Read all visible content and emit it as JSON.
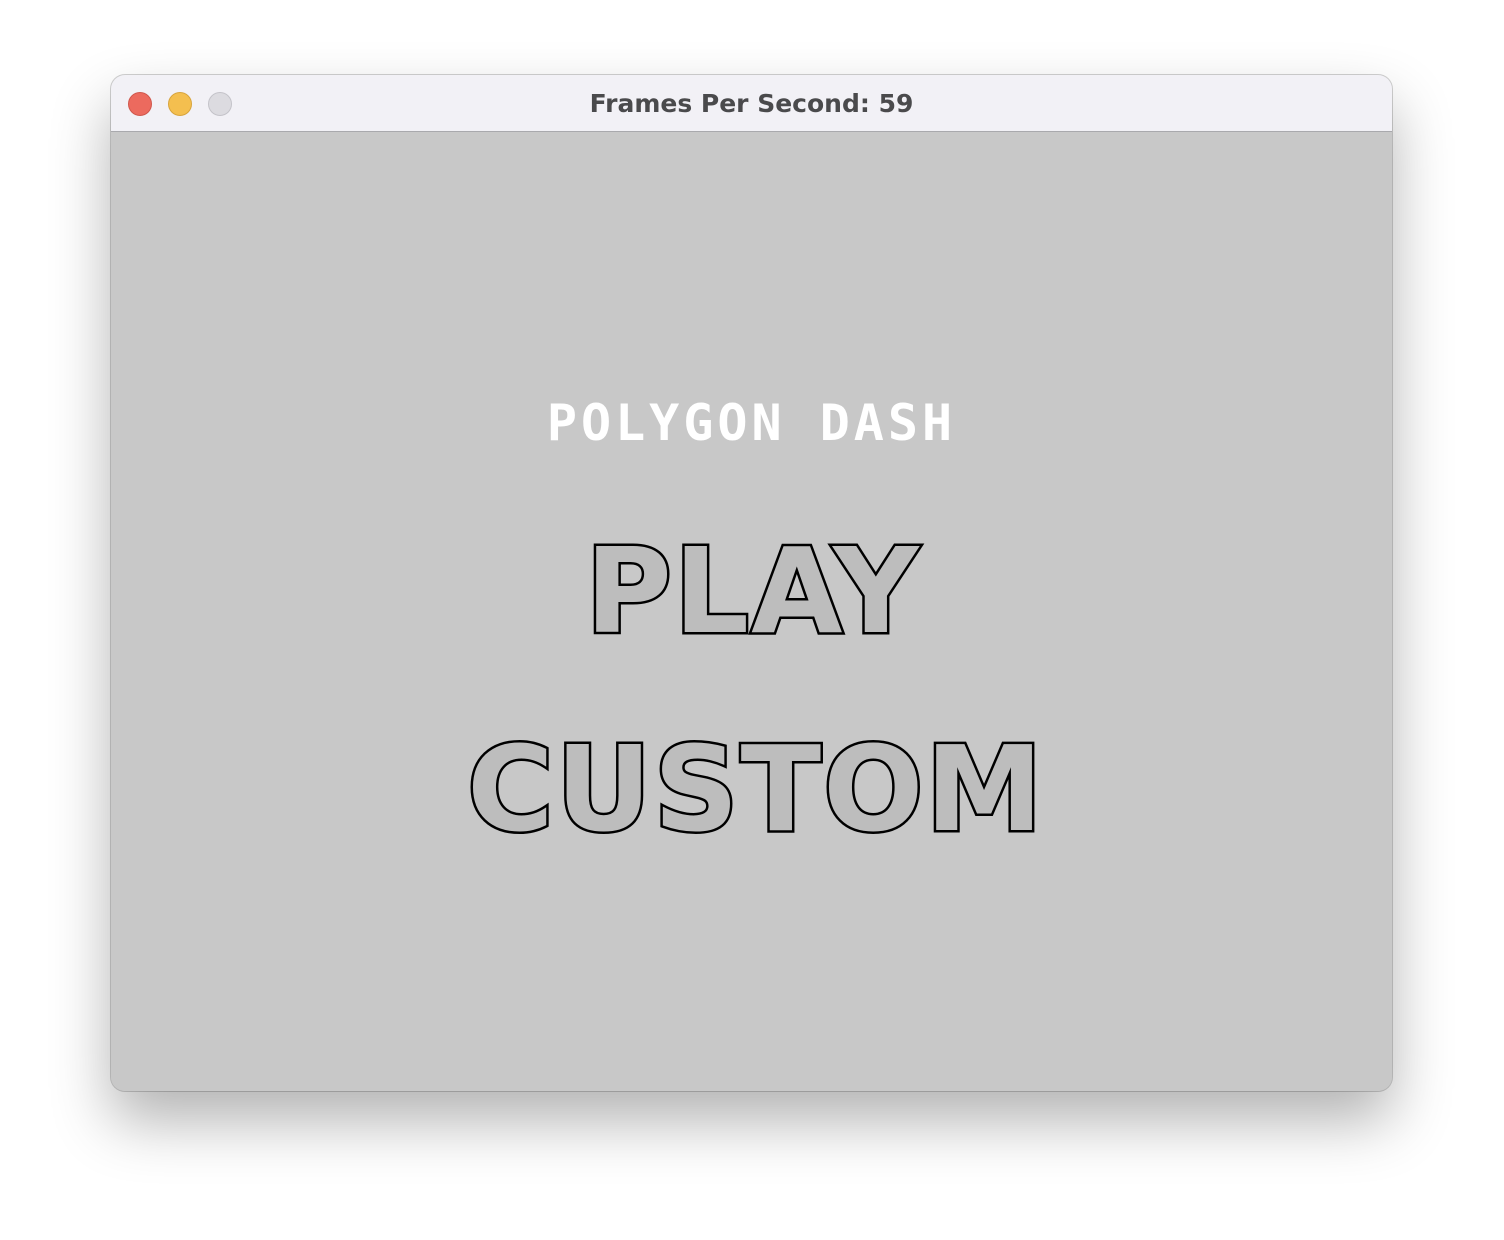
{
  "window": {
    "title": "Frames Per Second: 59",
    "controls": [
      "close-icon",
      "minimize-icon",
      "zoom-icon"
    ]
  },
  "game": {
    "title": "POLYGON DASH",
    "menu": {
      "play_label": "PLAY",
      "custom_label": "CUSTOM"
    },
    "background_color": "#c8c8c8",
    "title_color": "#ffffff",
    "menu_text_color": "#000000"
  }
}
